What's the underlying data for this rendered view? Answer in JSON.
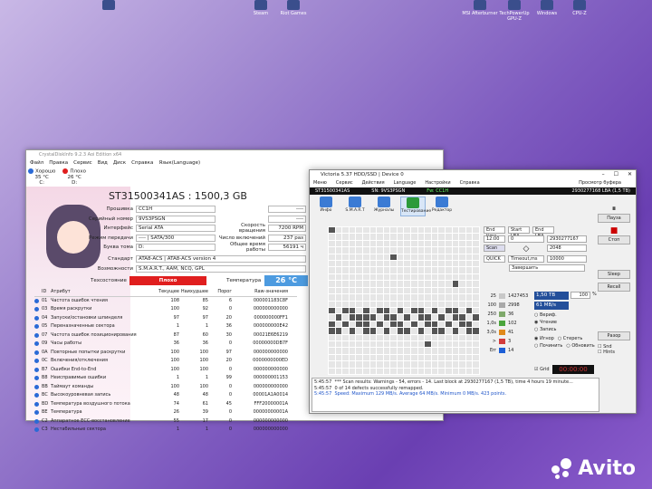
{
  "desktop": {
    "icons": [
      "Steam",
      "Riot Games",
      "MSI Afterburner",
      "TechPowerUp GPU-Z",
      "Windows",
      "CPU-Z"
    ]
  },
  "watermark": "Avito",
  "cdi": {
    "title": "CrystalDiskInfo 9.2.3 Aoi Edition x64",
    "menu": [
      "Файл",
      "Правка",
      "Сервис",
      "Вид",
      "Диск",
      "Справка",
      "Язык(Language)"
    ],
    "drives": [
      {
        "state": "Хорошо",
        "temp": "35 °C",
        "letter": "C:",
        "color": "#2a6ad6"
      },
      {
        "state": "Плохо",
        "temp": "26 °C",
        "letter": "D:",
        "color": "#e01e1e"
      }
    ],
    "model": "ST31500341AS : 1500,3 GB",
    "left_fields": [
      {
        "label": "Прошивка",
        "value": "CC1H"
      },
      {
        "label": "Серийный номер",
        "value": "9VS3PSGN"
      },
      {
        "label": "Интерфейс",
        "value": "Serial ATA"
      },
      {
        "label": "Режим передачи",
        "value": "---- | SATA/300"
      },
      {
        "label": "Буква тома",
        "value": "D:"
      },
      {
        "label": "Стандарт",
        "value": "ATA8-ACS | ATA8-ACS version 4"
      },
      {
        "label": "Возможности",
        "value": "S.M.A.R.T., AAM, NCQ, GPL"
      }
    ],
    "right_fields": [
      {
        "label": "",
        "value": "----"
      },
      {
        "label": "",
        "value": "----"
      },
      {
        "label": "Скорость вращения",
        "value": "7200 RPM"
      },
      {
        "label": "Число включений",
        "value": "237 раз"
      },
      {
        "label": "Общее время работы",
        "value": "56191 ч"
      }
    ],
    "status_label": "Техсостояние",
    "status_value": "Плохо",
    "temp_label": "Температура",
    "temp_value": "26 °C",
    "attr_headers": [
      "ID",
      "Атрибут",
      "Текущее",
      "Наихудшее",
      "Порог",
      "Raw-значения"
    ],
    "attributes": [
      [
        "01",
        "Частота ошибок чтения",
        "108",
        "85",
        "6",
        "000001183C8F"
      ],
      [
        "03",
        "Время раскрутки",
        "100",
        "92",
        "0",
        "000000000000"
      ],
      [
        "04",
        "Запуски/остановки шпинделя",
        "97",
        "97",
        "20",
        "000000000FF1"
      ],
      [
        "05",
        "Переназначенные сектора",
        "1",
        "1",
        "36",
        "000000000E42"
      ],
      [
        "07",
        "Частота ошибок позиционирования",
        "87",
        "60",
        "30",
        "00021E6E6219"
      ],
      [
        "09",
        "Часы работы",
        "36",
        "36",
        "0",
        "00000000DB7F"
      ],
      [
        "0A",
        "Повторные попытки раскрутки",
        "100",
        "100",
        "97",
        "000000000000"
      ],
      [
        "0C",
        "Включения/отключения",
        "100",
        "100",
        "20",
        "0000000000ED"
      ],
      [
        "B7",
        "Ошибки End-to-End",
        "100",
        "100",
        "0",
        "000000000000"
      ],
      [
        "B8",
        "Неисправимые ошибки",
        "1",
        "1",
        "99",
        "000000001153"
      ],
      [
        "BB",
        "Таймаут команды",
        "100",
        "100",
        "0",
        "000000000000"
      ],
      [
        "BC",
        "Высокоуровневая запись",
        "48",
        "48",
        "0",
        "00001A1A0014"
      ],
      [
        "BD",
        "Температура воздушного потока",
        "74",
        "61",
        "45",
        "FFF20000001A"
      ],
      [
        "BE",
        "Температура",
        "26",
        "39",
        "0",
        "00000000001A"
      ],
      [
        "C2",
        "Аппаратное ECC-восстановление",
        "55",
        "17",
        "0",
        "000000000000"
      ],
      [
        "C3",
        "Нестабильные сектора",
        "1",
        "1",
        "0",
        "000000000000"
      ]
    ]
  },
  "victoria": {
    "title": "Victoria 5.37 HDD/SSD | Device 0",
    "menu": [
      "Меню",
      "Сервис",
      "Действия",
      "Language",
      "Настройки",
      "Справка"
    ],
    "drive_model": "ST31500341AS",
    "sn": "SN: 9VS3PSGN",
    "fw": "Fw: CC1H",
    "lba": "2930277168 LBA (1,5 TB)",
    "buffer": "Просмотр буфера",
    "tools": [
      "Инфо",
      "S.M.A.R.T",
      "Журналы",
      "Тестирование",
      "Редактор"
    ],
    "right_buttons": [
      "Пауза",
      "Стоп",
      "Sleep",
      "Recall",
      "Разор"
    ],
    "end_lba": "2930277167",
    "start_lba": "0",
    "timer": "12:00",
    "block": "2048",
    "timeout": "10000",
    "mode": "Завершить",
    "speed": "1,50 TB",
    "pct": "100",
    "mbps": "61 MB/s",
    "blocks": [
      {
        "ms": "25",
        "count": "1427453",
        "color": "#c8c8c8"
      },
      {
        "ms": "100",
        "count": "2998",
        "color": "#a8a8a8"
      },
      {
        "ms": "250",
        "count": "36",
        "color": "#7ea86a"
      },
      {
        "ms": "1,0s",
        "count": "102",
        "color": "#4aa53c"
      },
      {
        "ms": "3,0s",
        "count": "41",
        "color": "#e08a1c"
      },
      {
        "ms": ">",
        "count": "3",
        "color": "#d23c3c"
      },
      {
        "ms": "Err",
        "count": "14",
        "color": "#1d5fd6"
      }
    ],
    "read_label": "Чтение",
    "write_label": "Запись",
    "verify_label": "Вериф.",
    "ignore_label": "Игнор",
    "erase_label": "Стереть",
    "fix_label": "Починить",
    "update_label": "Обновить",
    "grid_label": "Grid",
    "timer_display": "00:00:00",
    "log": [
      {
        "t": "5:45:57",
        "m": "*** Scan results: Warnings - 54, errors - 14. Last block at 2930277167 (1,5 TB), time 4 hours 19 minute..."
      },
      {
        "t": "5:45:57",
        "m": "0 of 14 defects successfully remapped."
      },
      {
        "t": "5:45:57",
        "m": "Speed: Maximum 129 MB/s. Average 64 MB/s. Minimum 0 MB/s. 423 points."
      }
    ],
    "side_checks": [
      "Snd",
      "Hints"
    ]
  }
}
